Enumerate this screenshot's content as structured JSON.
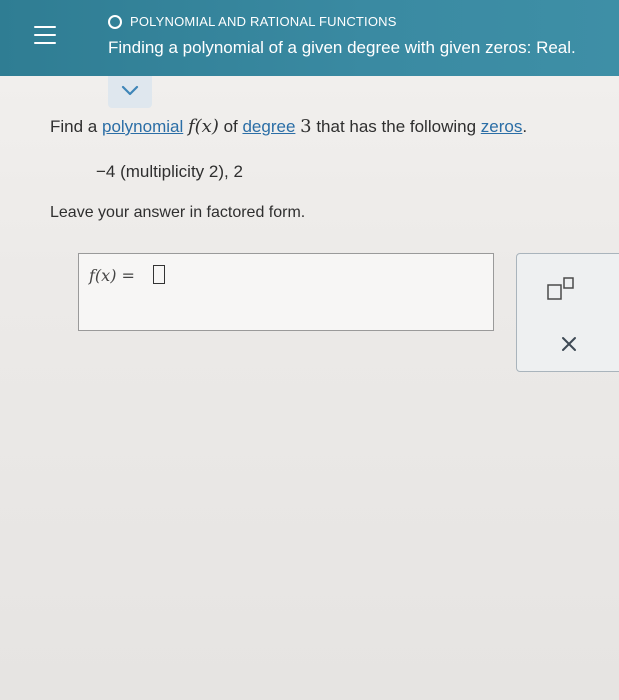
{
  "header": {
    "topic": "POLYNOMIAL AND RATIONAL FUNCTIONS",
    "title": "Finding a polynomial of a given degree with given zeros: Real."
  },
  "question": {
    "prefix": "Find a ",
    "polynomial_link": "polynomial",
    "function_expr": "f(x)",
    "of_text": " of ",
    "degree_link": "degree",
    "degree_value": "3",
    "middle_text": " that has the following ",
    "zeros_link": "zeros",
    "period": ".",
    "zeros_list": "−4 (multiplicity 2),  2",
    "instruction": "Leave your answer in factored form."
  },
  "answer": {
    "label": "f(x) =",
    "value": ""
  },
  "tools": {
    "superscript_icon": "superscript-icon",
    "clear_icon": "close-icon"
  },
  "colors": {
    "header_bg": "#2f7d93",
    "link": "#2b6ea6",
    "chevron_bg": "#dfe7ee"
  }
}
